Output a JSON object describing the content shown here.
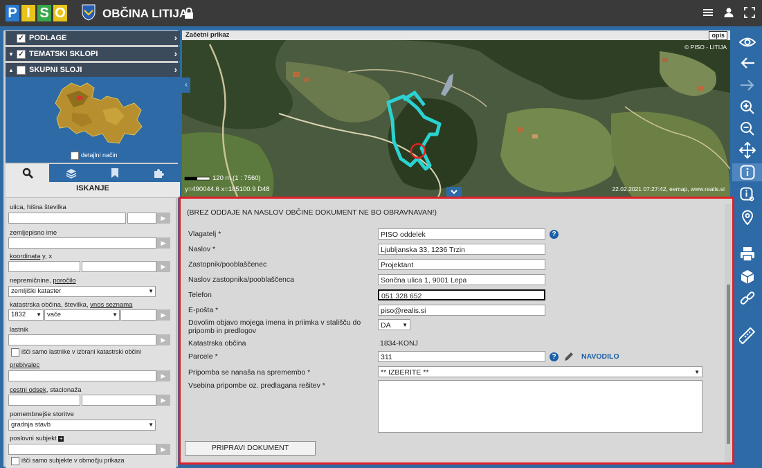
{
  "app": {
    "logo_letters": [
      "P",
      "I",
      "S",
      "O"
    ],
    "logo_colors": [
      "#2a7bd0",
      "#e7c41b",
      "#3aa74a",
      "#e7c41b"
    ],
    "title": "OBČINA LITIJA"
  },
  "layers": [
    {
      "label": "PODLAGE",
      "checked": true
    },
    {
      "label": "TEMATSKI SKLOPI",
      "checked": true
    },
    {
      "label": "SKUPNI SLOJI",
      "checked": false
    }
  ],
  "thumb": {
    "detail_label": "detajlni način"
  },
  "tabs": [
    "search-icon",
    "layers-icon",
    "bookmark-icon",
    "puzzle-icon"
  ],
  "search": {
    "title": "ISKANJE",
    "street_label": "ulica, hišna številka",
    "place_label": "zemljepisno ime",
    "coord_label_link": "koordinata",
    "coord_label_rest": " y, x",
    "realestate_label": "nepremičnine, ",
    "realestate_link": "poročilo",
    "realestate_value": "zemljiški kataster",
    "cadastral_label": "katastrska občina, številka, ",
    "cadastral_link": "vnos seznama",
    "cadastral_code": "1832",
    "cadastral_name": "vače",
    "owner_label": "lastnik",
    "owner_check_label": "išči samo lastnike v izbrani katastrski občini",
    "resident_label": "prebivalec",
    "road_label_link": "cestni odsek",
    "road_label_rest": ", stacionaža",
    "services_label": "pomembnejše storitve",
    "services_value": "gradnja stavb",
    "business_label": "poslovni subjekt",
    "business_check_label": "išči samo subjekte v območju prikaza"
  },
  "map": {
    "header": "Začetni prikaz",
    "opis": "opis",
    "copyright": "© PISO - LITIJA",
    "scale_text": "120 m  (1 : 7560)",
    "coords": "y=490044.6  x=105100.9  D48",
    "timestamp": "22.02.2021 07:27:42, eemap, www.realis.si"
  },
  "form": {
    "notice": "(BREZ ODDAJE NA NASLOV OBČINE DOKUMENT NE BO OBRAVNAVAN!)",
    "fields": [
      {
        "label": "Vlagatelj *",
        "value": "PISO oddelek"
      },
      {
        "label": "Naslov *",
        "value": "Ljubljanska 33, 1236 Trzin"
      },
      {
        "label": "Zastopnik/pooblaščenec",
        "value": "Projektant"
      },
      {
        "label": "Naslov zastopnika/pooblaščenca",
        "value": "Sončna ulica 1, 9001 Lepa"
      },
      {
        "label": "Telefon",
        "value": "051 328 652"
      },
      {
        "label": "E-pošta *",
        "value": "piso@realis.si"
      }
    ],
    "consent_label": "Dovolim objavo mojega imena in priimka v stališču do pripomb in predlogov",
    "consent_value": "DA",
    "kataster_label": "Katastrska občina",
    "kataster_value": "1834-KONJ",
    "parcel_label": "Parcele *",
    "parcel_value": "311",
    "navodilo": "NAVODILO",
    "change_label": "Pripomba se nanaša na spremembo *",
    "change_value": "** IZBERITE **",
    "content_label": "Vsebina pripombe oz. predlagana rešitev *",
    "submit": "PRIPRAVI DOKUMENT"
  }
}
